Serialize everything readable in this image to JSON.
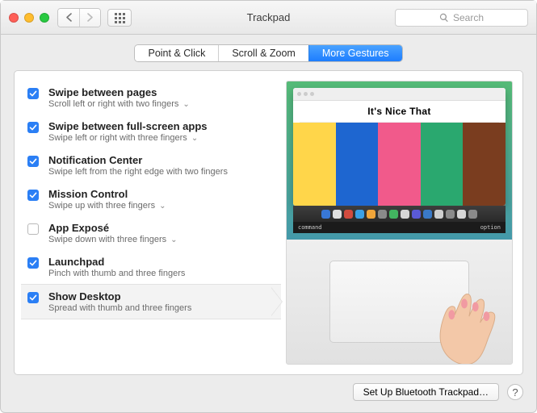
{
  "window": {
    "title": "Trackpad"
  },
  "search": {
    "placeholder": "Search"
  },
  "tabs": [
    {
      "label": "Point & Click",
      "active": false
    },
    {
      "label": "Scroll & Zoom",
      "active": false
    },
    {
      "label": "More Gestures",
      "active": true
    }
  ],
  "options": [
    {
      "title": "Swipe between pages",
      "subtitle": "Scroll left or right with two fingers",
      "checked": true,
      "has_dropdown": true,
      "selected": false
    },
    {
      "title": "Swipe between full-screen apps",
      "subtitle": "Swipe left or right with three fingers",
      "checked": true,
      "has_dropdown": true,
      "selected": false
    },
    {
      "title": "Notification Center",
      "subtitle": "Swipe left from the right edge with two fingers",
      "checked": true,
      "has_dropdown": false,
      "selected": false
    },
    {
      "title": "Mission Control",
      "subtitle": "Swipe up with three fingers",
      "checked": true,
      "has_dropdown": true,
      "selected": false
    },
    {
      "title": "App Exposé",
      "subtitle": "Swipe down with three fingers",
      "checked": false,
      "has_dropdown": true,
      "selected": false
    },
    {
      "title": "Launchpad",
      "subtitle": "Pinch with thumb and three fingers",
      "checked": true,
      "has_dropdown": false,
      "selected": false
    },
    {
      "title": "Show Desktop",
      "subtitle": "Spread with thumb and three fingers",
      "checked": true,
      "has_dropdown": false,
      "selected": true
    }
  ],
  "preview": {
    "browser_title": "It's Nice That",
    "key_left": "command",
    "key_right": "option"
  },
  "footer": {
    "bluetooth_button": "Set Up Bluetooth Trackpad…",
    "help": "?"
  }
}
